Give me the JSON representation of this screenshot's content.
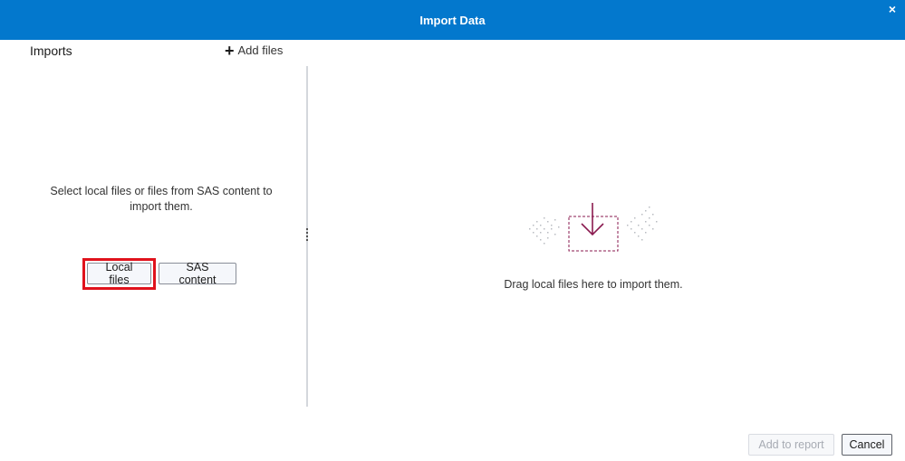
{
  "dialog": {
    "title": "Import Data",
    "close_label": "×"
  },
  "imports": {
    "heading": "Imports",
    "add_files_label": "Add files",
    "empty_message": "Select local files or files from SAS content to import them.",
    "local_files_label": "Local files",
    "sas_content_label": "SAS content"
  },
  "dropzone": {
    "message": "Drag local files here to import them."
  },
  "footer": {
    "add_to_report_label": "Add to report",
    "cancel_label": "Cancel"
  },
  "colors": {
    "titlebar": "#0378cd",
    "highlight": "#e0121c",
    "illustration": "#8a1a4f"
  }
}
